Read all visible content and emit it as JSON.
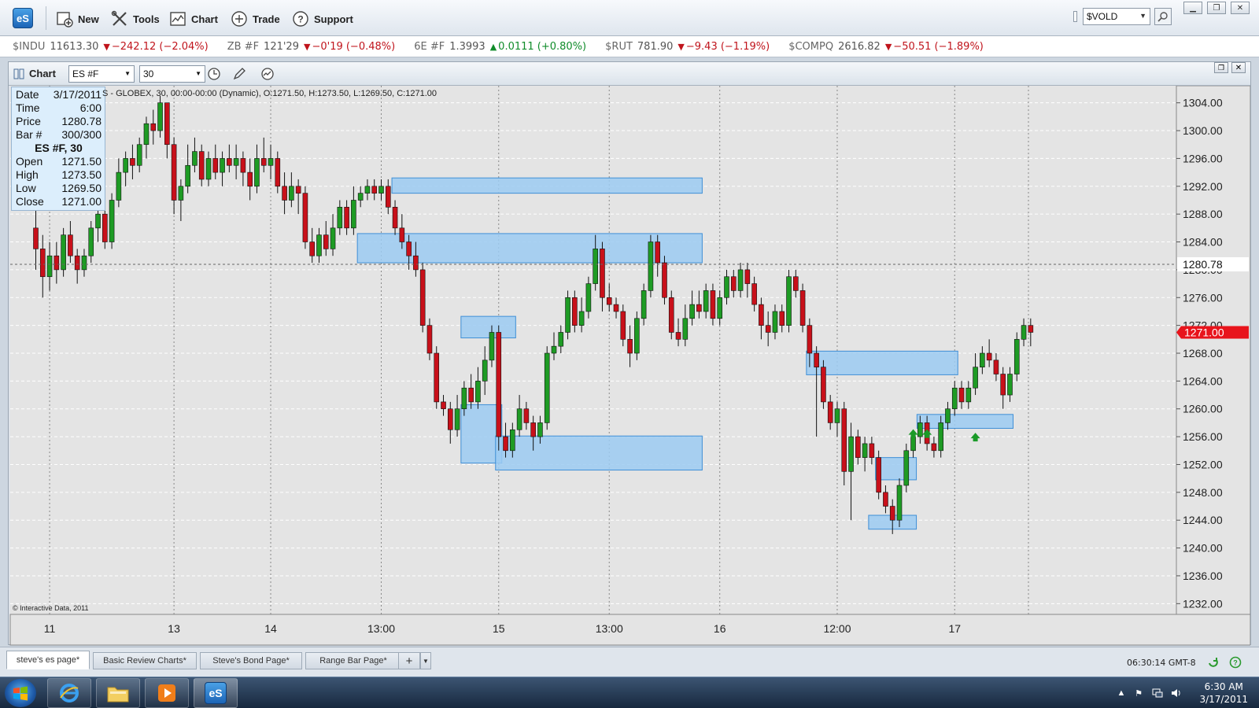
{
  "toolbar": {
    "logo": "eS",
    "buttons": [
      {
        "label": "New",
        "icon": "new-document-icon"
      },
      {
        "label": "Tools",
        "icon": "tools-icon"
      },
      {
        "label": "Chart",
        "icon": "chart-icon"
      },
      {
        "label": "Trade",
        "icon": "trade-icon"
      },
      {
        "label": "Support",
        "icon": "help-icon"
      }
    ],
    "symbol_value": "$VOLD"
  },
  "ticker": [
    {
      "symbol": "$INDU",
      "price": "11613.30",
      "change": "−242.12 (−2.04%)",
      "direction": "down"
    },
    {
      "symbol": "ZB #F",
      "price": "121'29",
      "change": "−0'19 (−0.48%)",
      "direction": "down"
    },
    {
      "symbol": "6E #F",
      "price": "1.3993",
      "change": "0.0111 (+0.80%)",
      "direction": "up"
    },
    {
      "symbol": "$RUT",
      "price": "781.90",
      "change": "−9.43 (−1.19%)",
      "direction": "down"
    },
    {
      "symbol": "$COMPQ",
      "price": "2616.82",
      "change": "−50.51 (−1.89%)",
      "direction": "down"
    }
  ],
  "chart_window": {
    "title": "Chart",
    "symbol": "ES #F",
    "interval": "30",
    "description": "S - GLOBEX, 30, 00:00-00:00 (Dynamic), O:1271.50, H:1273.50, L:1269.50, C:1271.00",
    "copyright": "© Interactive Data, 2011",
    "info": {
      "rows_top": [
        {
          "label": "Date",
          "value": "3/17/2011"
        },
        {
          "label": "Time",
          "value": "6:00"
        },
        {
          "label": "Price",
          "value": "1280.78"
        },
        {
          "label": "Bar #",
          "value": "300/300"
        }
      ],
      "heading": "ES #F, 30",
      "rows_bottom": [
        {
          "label": "Open",
          "value": "1271.50"
        },
        {
          "label": "High",
          "value": "1273.50"
        },
        {
          "label": "Low",
          "value": "1269.50"
        },
        {
          "label": "Close",
          "value": "1271.00"
        }
      ]
    },
    "crosshair_price": "1280.78",
    "last_price": "1271.00",
    "colors": {
      "up": "#1e9b24",
      "down": "#c8101a",
      "zone_fill": "#9ccbf2",
      "zone_stroke": "#3f8fd6",
      "last_price_bg": "#e8141c"
    }
  },
  "chart_data": {
    "type": "candlestick",
    "ylim": [
      1230,
      1306
    ],
    "y_ticks": [
      "1304.00",
      "1300.00",
      "1296.00",
      "1292.00",
      "1288.00",
      "1284.00",
      "1280.00",
      "1276.00",
      "1272.00",
      "1268.00",
      "1264.00",
      "1260.00",
      "1256.00",
      "1252.00",
      "1248.00",
      "1244.00",
      "1240.00",
      "1236.00",
      "1232.00"
    ],
    "x_ticks": [
      {
        "label": "11",
        "bar": 2
      },
      {
        "label": "13",
        "bar": 20
      },
      {
        "label": "14",
        "bar": 34
      },
      {
        "label": "13:00",
        "bar": 50
      },
      {
        "label": "15",
        "bar": 67
      },
      {
        "label": "13:00",
        "bar": 83
      },
      {
        "label": "16",
        "bar": 99
      },
      {
        "label": "12:00",
        "bar": 116
      },
      {
        "label": "17",
        "bar": 133
      }
    ],
    "candles": [
      [
        1286,
        1283,
        1289,
        1280
      ],
      [
        1283,
        1279,
        1285,
        1276
      ],
      [
        1279,
        1282,
        1284,
        1277
      ],
      [
        1282,
        1280,
        1284,
        1278
      ],
      [
        1280,
        1285,
        1286,
        1279
      ],
      [
        1285,
        1282,
        1287,
        1281
      ],
      [
        1282,
        1280,
        1283,
        1278
      ],
      [
        1280,
        1282,
        1283,
        1279
      ],
      [
        1282,
        1286,
        1287,
        1281
      ],
      [
        1286,
        1288,
        1289,
        1284
      ],
      [
        1288,
        1284,
        1290,
        1283
      ],
      [
        1284,
        1290,
        1291,
        1283
      ],
      [
        1290,
        1294,
        1296,
        1289
      ],
      [
        1294,
        1296,
        1297,
        1292
      ],
      [
        1296,
        1295,
        1298,
        1293
      ],
      [
        1295,
        1298,
        1299,
        1294
      ],
      [
        1298,
        1301,
        1302,
        1296
      ],
      [
        1301,
        1300,
        1303,
        1298
      ],
      [
        1300,
        1304,
        1305,
        1299
      ],
      [
        1304,
        1298,
        1304,
        1296
      ],
      [
        1298,
        1290,
        1299,
        1288
      ],
      [
        1290,
        1292,
        1293,
        1287
      ],
      [
        1292,
        1295,
        1298,
        1291
      ],
      [
        1295,
        1297,
        1299,
        1294
      ],
      [
        1297,
        1293,
        1298,
        1292
      ],
      [
        1293,
        1296,
        1297,
        1292
      ],
      [
        1296,
        1294,
        1298,
        1293
      ],
      [
        1294,
        1296,
        1297,
        1292
      ],
      [
        1296,
        1295,
        1298,
        1294
      ],
      [
        1295,
        1296,
        1298,
        1293
      ],
      [
        1296,
        1294,
        1297,
        1292
      ],
      [
        1294,
        1292,
        1296,
        1290
      ],
      [
        1292,
        1296,
        1298,
        1291
      ],
      [
        1296,
        1295,
        1299,
        1294
      ],
      [
        1295,
        1296,
        1298,
        1293
      ],
      [
        1296,
        1292,
        1297,
        1291
      ],
      [
        1292,
        1290,
        1294,
        1288
      ],
      [
        1290,
        1292,
        1294,
        1289
      ],
      [
        1292,
        1291,
        1293,
        1288
      ],
      [
        1291,
        1284,
        1292,
        1283
      ],
      [
        1284,
        1282,
        1286,
        1281
      ],
      [
        1282,
        1285,
        1286,
        1281
      ],
      [
        1285,
        1283,
        1287,
        1282
      ],
      [
        1283,
        1286,
        1288,
        1282
      ],
      [
        1286,
        1289,
        1290,
        1285
      ],
      [
        1289,
        1286,
        1290,
        1285
      ],
      [
        1286,
        1290,
        1292,
        1285
      ],
      [
        1290,
        1291,
        1292,
        1289
      ],
      [
        1291,
        1292,
        1293,
        1290
      ],
      [
        1292,
        1291,
        1293,
        1290
      ],
      [
        1291,
        1292,
        1293,
        1290
      ],
      [
        1292,
        1289,
        1293,
        1288
      ],
      [
        1289,
        1286,
        1290,
        1285
      ],
      [
        1286,
        1284,
        1288,
        1283
      ],
      [
        1284,
        1282,
        1285,
        1280
      ],
      [
        1282,
        1280,
        1284,
        1279
      ],
      [
        1280,
        1272,
        1281,
        1271
      ],
      [
        1272,
        1268,
        1273,
        1267
      ],
      [
        1268,
        1261,
        1269,
        1260
      ],
      [
        1261,
        1260,
        1262,
        1259
      ],
      [
        1260,
        1257,
        1261,
        1255
      ],
      [
        1257,
        1260,
        1262,
        1256
      ],
      [
        1260,
        1263,
        1264,
        1259
      ],
      [
        1263,
        1261,
        1265,
        1260
      ],
      [
        1261,
        1264,
        1266,
        1260
      ],
      [
        1264,
        1267,
        1269,
        1262
      ],
      [
        1267,
        1271,
        1272,
        1266
      ],
      [
        1271,
        1256,
        1272,
        1254
      ],
      [
        1256,
        1254,
        1258,
        1253
      ],
      [
        1254,
        1257,
        1258,
        1253
      ],
      [
        1257,
        1260,
        1262,
        1256
      ],
      [
        1260,
        1258,
        1261,
        1257
      ],
      [
        1258,
        1256,
        1259,
        1254
      ],
      [
        1256,
        1258,
        1259,
        1255
      ],
      [
        1258,
        1268,
        1269,
        1257
      ],
      [
        1268,
        1269,
        1271,
        1267
      ],
      [
        1269,
        1271,
        1272,
        1268
      ],
      [
        1271,
        1276,
        1277,
        1270
      ],
      [
        1276,
        1272,
        1277,
        1271
      ],
      [
        1272,
        1274,
        1276,
        1271
      ],
      [
        1274,
        1278,
        1279,
        1273
      ],
      [
        1278,
        1283,
        1285,
        1277
      ],
      [
        1283,
        1276,
        1284,
        1274
      ],
      [
        1276,
        1275,
        1278,
        1274
      ],
      [
        1275,
        1274,
        1276,
        1273
      ],
      [
        1274,
        1270,
        1275,
        1269
      ],
      [
        1270,
        1268,
        1272,
        1266
      ],
      [
        1268,
        1273,
        1274,
        1267
      ],
      [
        1273,
        1277,
        1278,
        1272
      ],
      [
        1277,
        1284,
        1285,
        1276
      ],
      [
        1284,
        1281,
        1285,
        1279
      ],
      [
        1281,
        1276,
        1282,
        1275
      ],
      [
        1276,
        1271,
        1277,
        1270
      ],
      [
        1271,
        1270,
        1273,
        1269
      ],
      [
        1270,
        1273,
        1275,
        1269
      ],
      [
        1273,
        1275,
        1277,
        1272
      ],
      [
        1275,
        1274,
        1277,
        1273
      ],
      [
        1274,
        1277,
        1278,
        1273
      ],
      [
        1277,
        1273,
        1278,
        1272
      ],
      [
        1273,
        1276,
        1277,
        1272
      ],
      [
        1276,
        1279,
        1280,
        1275
      ],
      [
        1279,
        1277,
        1280,
        1276
      ],
      [
        1277,
        1280,
        1281,
        1276
      ],
      [
        1280,
        1278,
        1281,
        1276
      ],
      [
        1278,
        1275,
        1279,
        1274
      ],
      [
        1275,
        1272,
        1276,
        1270
      ],
      [
        1272,
        1271,
        1274,
        1269
      ],
      [
        1271,
        1274,
        1275,
        1270
      ],
      [
        1274,
        1272,
        1275,
        1271
      ],
      [
        1272,
        1279,
        1280,
        1271
      ],
      [
        1279,
        1277,
        1280,
        1276
      ],
      [
        1277,
        1272,
        1278,
        1271
      ],
      [
        1272,
        1268,
        1273,
        1266
      ],
      [
        1268,
        1266,
        1269,
        1256
      ],
      [
        1266,
        1261,
        1267,
        1260
      ],
      [
        1261,
        1258,
        1262,
        1257
      ],
      [
        1258,
        1260,
        1261,
        1256
      ],
      [
        1260,
        1251,
        1261,
        1249
      ],
      [
        1251,
        1256,
        1258,
        1244
      ],
      [
        1256,
        1253,
        1257,
        1252
      ],
      [
        1253,
        1255,
        1256,
        1251
      ],
      [
        1255,
        1253,
        1256,
        1252
      ],
      [
        1253,
        1248,
        1254,
        1247
      ],
      [
        1248,
        1246,
        1249,
        1245
      ],
      [
        1246,
        1244,
        1247,
        1242
      ],
      [
        1244,
        1249,
        1250,
        1243
      ],
      [
        1249,
        1254,
        1255,
        1248
      ],
      [
        1254,
        1256,
        1257,
        1253
      ],
      [
        1256,
        1258,
        1259,
        1255
      ],
      [
        1258,
        1255,
        1259,
        1254
      ],
      [
        1255,
        1254,
        1256,
        1253
      ],
      [
        1254,
        1258,
        1259,
        1253
      ],
      [
        1258,
        1260,
        1261,
        1257
      ],
      [
        1260,
        1263,
        1264,
        1259
      ],
      [
        1263,
        1261,
        1264,
        1260
      ],
      [
        1261,
        1263,
        1264,
        1260
      ],
      [
        1263,
        1266,
        1268,
        1262
      ],
      [
        1266,
        1268,
        1269,
        1265
      ],
      [
        1268,
        1267,
        1270,
        1266
      ],
      [
        1267,
        1265,
        1268,
        1264
      ],
      [
        1265,
        1262,
        1266,
        1260
      ],
      [
        1262,
        1265,
        1266,
        1261
      ],
      [
        1265,
        1270,
        1271,
        1264
      ],
      [
        1270,
        1272,
        1273,
        1269
      ],
      [
        1272,
        1271,
        1273,
        1269
      ]
    ],
    "zones": [
      {
        "x1": 52,
        "x2": 96,
        "top": 1293.2,
        "bottom": 1291.0
      },
      {
        "x1": 47,
        "x2": 96,
        "top": 1285.2,
        "bottom": 1281.0
      },
      {
        "x1": 62,
        "x2": 69,
        "top": 1273.3,
        "bottom": 1270.2
      },
      {
        "x1": 62,
        "x2": 67,
        "top": 1260.6,
        "bottom": 1252.2
      },
      {
        "x1": 67,
        "x2": 96,
        "top": 1256.1,
        "bottom": 1251.2
      },
      {
        "x1": 112,
        "x2": 133,
        "top": 1268.3,
        "bottom": 1264.9
      },
      {
        "x1": 128,
        "x2": 141,
        "top": 1259.2,
        "bottom": 1257.2
      },
      {
        "x1": 122,
        "x2": 127,
        "top": 1253.0,
        "bottom": 1249.8
      },
      {
        "x1": 121,
        "x2": 127,
        "top": 1244.7,
        "bottom": 1242.7
      }
    ],
    "signals": [
      {
        "bar": 127,
        "price": 1256.5
      },
      {
        "bar": 129,
        "price": 1256.5
      },
      {
        "bar": 136,
        "price": 1256.0
      }
    ],
    "crosshair": {
      "bar": 116,
      "price": 1280.78
    }
  },
  "bottom_tabs": {
    "tabs": [
      "steve's es page*",
      "Basic Review Charts*",
      "Steve's Bond Page*",
      "Range Bar Page*"
    ],
    "add_label": "+",
    "time": "06:30:14 GMT-8"
  },
  "taskbar": {
    "apps": [
      "internet-explorer-icon",
      "folder-icon",
      "media-player-icon",
      "esignal-icon"
    ],
    "esignal_label": "eS",
    "clock_time": "6:30 AM",
    "clock_date": "3/17/2011"
  }
}
